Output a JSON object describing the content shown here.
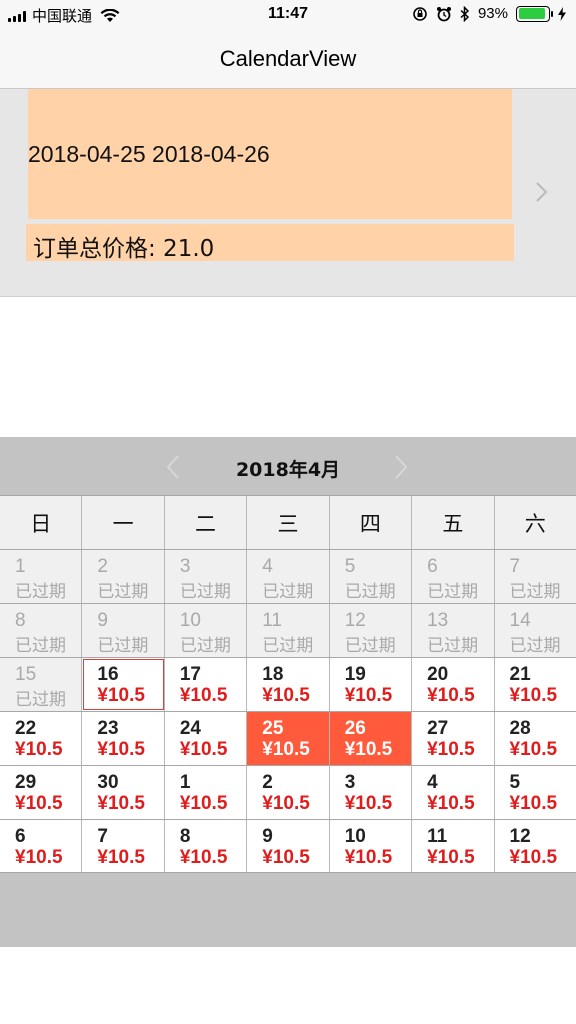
{
  "status_bar": {
    "carrier": "中国联通",
    "time": "11:47",
    "battery_percent": "93%",
    "battery_level": 0.93
  },
  "nav": {
    "title": "CalendarView"
  },
  "order": {
    "dates": "2018-04-25 2018-04-26",
    "total_price": "订单总价格: 21.0"
  },
  "calendar": {
    "month_title": "2018年4月",
    "weekdays": [
      "日",
      "一",
      "二",
      "三",
      "四",
      "五",
      "六"
    ],
    "weeks": [
      [
        {
          "day": "1",
          "sub": "已过期",
          "state": "past"
        },
        {
          "day": "2",
          "sub": "已过期",
          "state": "past"
        },
        {
          "day": "3",
          "sub": "已过期",
          "state": "past"
        },
        {
          "day": "4",
          "sub": "已过期",
          "state": "past"
        },
        {
          "day": "5",
          "sub": "已过期",
          "state": "past"
        },
        {
          "day": "6",
          "sub": "已过期",
          "state": "past"
        },
        {
          "day": "7",
          "sub": "已过期",
          "state": "past"
        }
      ],
      [
        {
          "day": "8",
          "sub": "已过期",
          "state": "past"
        },
        {
          "day": "9",
          "sub": "已过期",
          "state": "past"
        },
        {
          "day": "10",
          "sub": "已过期",
          "state": "past"
        },
        {
          "day": "11",
          "sub": "已过期",
          "state": "past"
        },
        {
          "day": "12",
          "sub": "已过期",
          "state": "past"
        },
        {
          "day": "13",
          "sub": "已过期",
          "state": "past"
        },
        {
          "day": "14",
          "sub": "已过期",
          "state": "past"
        }
      ],
      [
        {
          "day": "15",
          "sub": "已过期",
          "state": "past"
        },
        {
          "day": "16",
          "sub": "¥10.5",
          "state": "today"
        },
        {
          "day": "17",
          "sub": "¥10.5",
          "state": "available"
        },
        {
          "day": "18",
          "sub": "¥10.5",
          "state": "available"
        },
        {
          "day": "19",
          "sub": "¥10.5",
          "state": "available"
        },
        {
          "day": "20",
          "sub": "¥10.5",
          "state": "available"
        },
        {
          "day": "21",
          "sub": "¥10.5",
          "state": "available"
        }
      ],
      [
        {
          "day": "22",
          "sub": "¥10.5",
          "state": "available"
        },
        {
          "day": "23",
          "sub": "¥10.5",
          "state": "available"
        },
        {
          "day": "24",
          "sub": "¥10.5",
          "state": "available"
        },
        {
          "day": "25",
          "sub": "¥10.5",
          "state": "selected"
        },
        {
          "day": "26",
          "sub": "¥10.5",
          "state": "selected"
        },
        {
          "day": "27",
          "sub": "¥10.5",
          "state": "available"
        },
        {
          "day": "28",
          "sub": "¥10.5",
          "state": "available"
        }
      ],
      [
        {
          "day": "29",
          "sub": "¥10.5",
          "state": "available"
        },
        {
          "day": "30",
          "sub": "¥10.5",
          "state": "available"
        },
        {
          "day": "1",
          "sub": "¥10.5",
          "state": "available"
        },
        {
          "day": "2",
          "sub": "¥10.5",
          "state": "available"
        },
        {
          "day": "3",
          "sub": "¥10.5",
          "state": "available"
        },
        {
          "day": "4",
          "sub": "¥10.5",
          "state": "available"
        },
        {
          "day": "5",
          "sub": "¥10.5",
          "state": "available"
        }
      ],
      [
        {
          "day": "6",
          "sub": "¥10.5",
          "state": "available"
        },
        {
          "day": "7",
          "sub": "¥10.5",
          "state": "available"
        },
        {
          "day": "8",
          "sub": "¥10.5",
          "state": "available"
        },
        {
          "day": "9",
          "sub": "¥10.5",
          "state": "available"
        },
        {
          "day": "10",
          "sub": "¥10.5",
          "state": "available"
        },
        {
          "day": "11",
          "sub": "¥10.5",
          "state": "available"
        },
        {
          "day": "12",
          "sub": "¥10.5",
          "state": "available"
        }
      ]
    ]
  },
  "colors": {
    "order_box": "#ffd2a8",
    "selected_day": "#ff5a3c",
    "price_red": "#e01c1c",
    "battery_green": "#2ecc40"
  },
  "icons": [
    "signal-icon",
    "wifi-icon",
    "orientation-lock-icon",
    "alarm-icon",
    "bluetooth-icon",
    "battery-icon",
    "charging-icon",
    "chevron-right-icon",
    "chevron-left-icon"
  ]
}
